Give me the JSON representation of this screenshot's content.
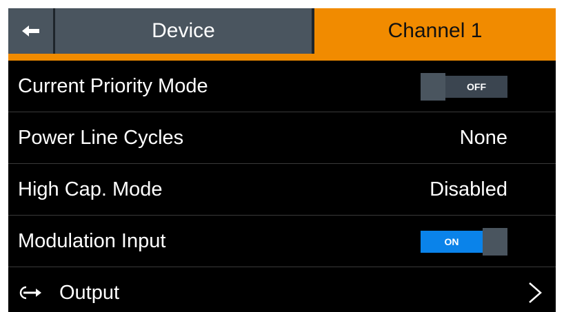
{
  "header": {
    "back_icon": "arrow-left-icon",
    "tabs": [
      {
        "label": "Device",
        "active": false
      },
      {
        "label": "Channel 1",
        "active": true
      }
    ]
  },
  "settings": [
    {
      "label": "Current Priority Mode",
      "type": "toggle",
      "state": "OFF"
    },
    {
      "label": "Power Line Cycles",
      "type": "value",
      "value": "None"
    },
    {
      "label": "High Cap. Mode",
      "type": "value",
      "value": "Disabled"
    },
    {
      "label": "Modulation Input",
      "type": "toggle",
      "state": "ON"
    },
    {
      "label": "Output",
      "type": "link",
      "icon": "output-arrow-icon",
      "chevron_icon": "chevron-right-icon"
    }
  ],
  "colors": {
    "accent": "#f18b00",
    "header_bg": "#4a555f",
    "toggle_on": "#0a83ea",
    "toggle_off": "#3b4550",
    "background": "#000000"
  }
}
